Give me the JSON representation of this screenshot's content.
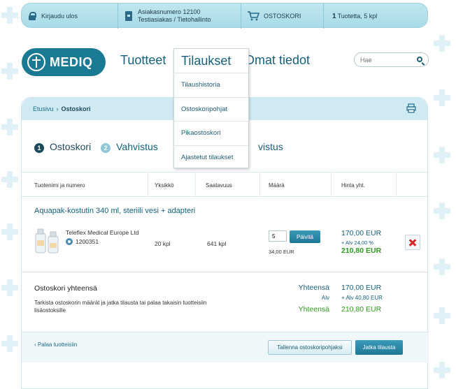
{
  "topbar": {
    "logout_label": "Kirjaudu ulos",
    "customer_number": "Asiakasnumero 12100",
    "customer_name": "Testiasiakas / Tietohallinto",
    "cart_label": "OSTOSKORI",
    "cart_count_num": "1",
    "cart_count_text": "Tuotetta, 5 kpl"
  },
  "logo": {
    "text": "MEDIQ"
  },
  "nav": {
    "products": "Tuotteet",
    "orders": "Tilaukset",
    "own_info": "Omat tiedot"
  },
  "dropdown": {
    "items": [
      "Tilaushistoria",
      "Ostoskoripohjat",
      "Pikaostoskori",
      "Ajastetut tilaukset"
    ]
  },
  "search": {
    "placeholder": "Hae"
  },
  "breadcrumb": {
    "home": "Etusivu",
    "separator": "›",
    "current": "Ostoskori"
  },
  "steps": {
    "step1_num": "1",
    "step1_label": "Ostoskori",
    "step2_num": "2",
    "step2_label": "Vahvistus",
    "step3_label": "vistus"
  },
  "table": {
    "headers": [
      "Tuotenimi ja numero",
      "Yksikkö",
      "Saatavuus",
      "Määrä",
      "Hinta yht."
    ]
  },
  "product": {
    "title": "Aquapak-kostutin 340 ml, steriili vesi + adapteri",
    "supplier": "Teleflex Medical Europe Ltd",
    "id": "1200351",
    "unit": "20 kpl",
    "availability": "641 kpl",
    "quantity": "5",
    "update_label": "Päivitä",
    "unit_price": "34,00 EUR",
    "price_excl": "170,00 EUR",
    "vat_line": "+ Alv 24,00 %",
    "price_incl": "210,80 EUR"
  },
  "totals": {
    "title": "Ostoskori yhteensä",
    "description": "Tarkista ostoskorin määrät ja jatka tilausta tai palaa takaisin tuotteisiin lisäostoksille",
    "label_total1": "Yhteensä",
    "value_total1": "170,00 EUR",
    "label_vat": "Alv",
    "value_vat": "+ Alv 40,80 EUR",
    "label_total2": "Yhteensä",
    "value_total2": "210,80 EUR"
  },
  "bottom": {
    "back_label": "Palaa tuotteisiin",
    "save_label": "Tallenna ostoskoripohjaksi",
    "continue_label": "Jatka tilausta"
  },
  "colors": {
    "brand": "#1a7a94",
    "link": "#17607a",
    "green": "#2e9a1c",
    "remove": "#d62828"
  }
}
